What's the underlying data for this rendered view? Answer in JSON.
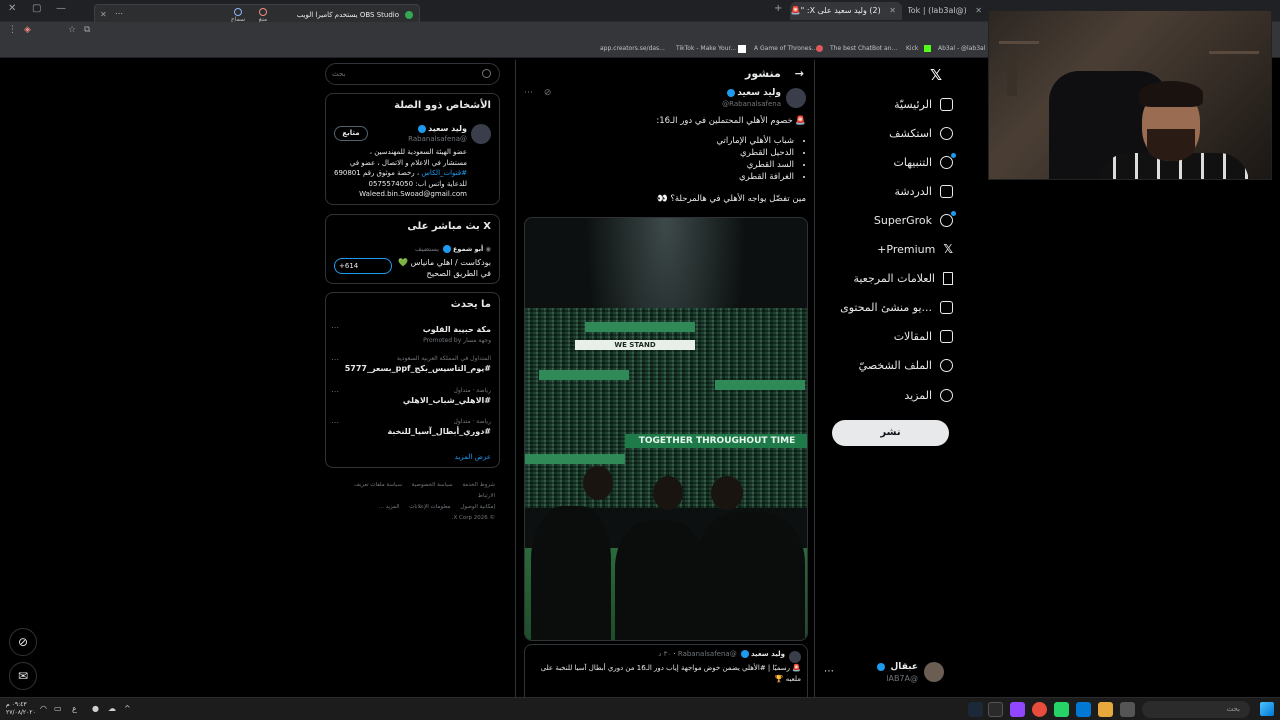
{
  "browser": {
    "tabs": [
      {
        "title": "Tik.Tok | (lab3al@) | ال...",
        "active": false
      },
      {
        "title": "(2) وليد سعيد على X: \"🚨 خصوم...",
        "active": true
      }
    ],
    "notification": {
      "text": "OBS Studio يستخدم كاميرا الويب",
      "allow": "سماح",
      "deny": "منع"
    },
    "bookmarks": [
      "app.creators.se/das...",
      "TikTok - Make Your...",
      "A Game of Thrones...",
      "The best ChatBot an...",
      "Kick",
      "Ab3al - @lab3al |..."
    ]
  },
  "nav": {
    "items": [
      {
        "label": "الرئيسيّة",
        "icon": "home-icon"
      },
      {
        "label": "استكشف",
        "icon": "search-icon"
      },
      {
        "label": "التنبيهات",
        "icon": "bell-icon"
      },
      {
        "label": "الدردشة",
        "icon": "mail-icon"
      },
      {
        "label": "SuperGrok",
        "icon": "grok-icon"
      },
      {
        "label": "Premium+",
        "icon": "x-premium-icon"
      },
      {
        "label": "العلامات المرجعية",
        "icon": "bookmark-icon"
      },
      {
        "label": "...يو منشئ المحتوى",
        "icon": "creator-icon"
      },
      {
        "label": "المقالات",
        "icon": "articles-icon"
      },
      {
        "label": "الملف الشخصيّ",
        "icon": "profile-icon"
      },
      {
        "label": "المزيد",
        "icon": "more-icon"
      }
    ],
    "post_button": "نشر",
    "account": {
      "name": "عبقال",
      "handle": "@lAB7A"
    }
  },
  "main": {
    "header": "منشور",
    "tweet": {
      "name": "وليد سعيد",
      "handle": "@Rabanalsafena",
      "intro": "🚨 خصوم الأهلي المحتملين في دور الـ16:",
      "list": [
        "شباب الأهلي الإماراتي",
        "الدحيل القطري",
        "السد القطري",
        "الغرافة القطري"
      ],
      "question": "مين تفضّل يواجه الأهلي في هالمرحلة؟ 👀",
      "banners": [
        "WE STAND",
        "TOGETHER THROUGHOUT TIME"
      ]
    },
    "reply": {
      "name": "وليد سعيد",
      "handle": "@Rabanalsafena",
      "time": "٣٠ د",
      "text": "🚨 رسميًا | #الأهلي يضمن خوض مواجهة إياب دور الـ16 من دوري أبطال آسيا للنخبة على ملعبه 🏆"
    }
  },
  "sidebar": {
    "search_placeholder": "بحث",
    "related": {
      "title": "الأشخاص ذوو الصلة",
      "name": "وليد سعيد",
      "handle": "@Rabanalsafena",
      "follow": "متابع",
      "bio_line1": "عضو الهيئة السعودية للمهندسين ،",
      "bio_line2": "مستشار في الاعلام و الاتصال ، عضو في",
      "bio_hashtag": "#قنوات_الكاس",
      "bio_line3": "، رخصة موثوق رقم 690801",
      "bio_line4": "للدعاية واتس اب: 0575574050",
      "bio_line5": "Waleed.bin.Swoad@gmail.com"
    },
    "live": {
      "title": "X بث مباشر على",
      "hosted_by": "يستضيف",
      "host": "أبو شموع",
      "name": "بودكاست / اهلي مانياس 💚 في الطريق الصحيح",
      "count": "+614"
    },
    "trends": {
      "title": "ما يحدث",
      "items": [
        {
          "meta": "",
          "name": "مكة حبيبة القلوب",
          "sub": "وجهة مسار Promoted by"
        },
        {
          "meta": "المتداول في المملكة العربية السعودية",
          "name": "#يوم_التاسيس_بكج_ppf_بسعر_5777",
          "sub": ""
        },
        {
          "meta": "رياضة · متداول",
          "name": "#الاهلي_شباب_الاهلي",
          "sub": ""
        },
        {
          "meta": "رياضة · متداول",
          "name": "#دوري_أبطال_آسيا_للنخبة",
          "sub": ""
        }
      ],
      "show_more": "عرض المزيد"
    },
    "footer": [
      "شروط الخدمة",
      "سياسة الخصوصية",
      "سياسة ملفات تعريف الارتباط",
      "إمكانية الوصول",
      "معلومات الإعلانات",
      "المزيد ...",
      "© 2026 X Corp."
    ]
  },
  "taskbar": {
    "search": "بحث",
    "clock_time": "٠٩:٤٣ م",
    "clock_date": "٢٧/٠٨/٢٠٢٠"
  }
}
